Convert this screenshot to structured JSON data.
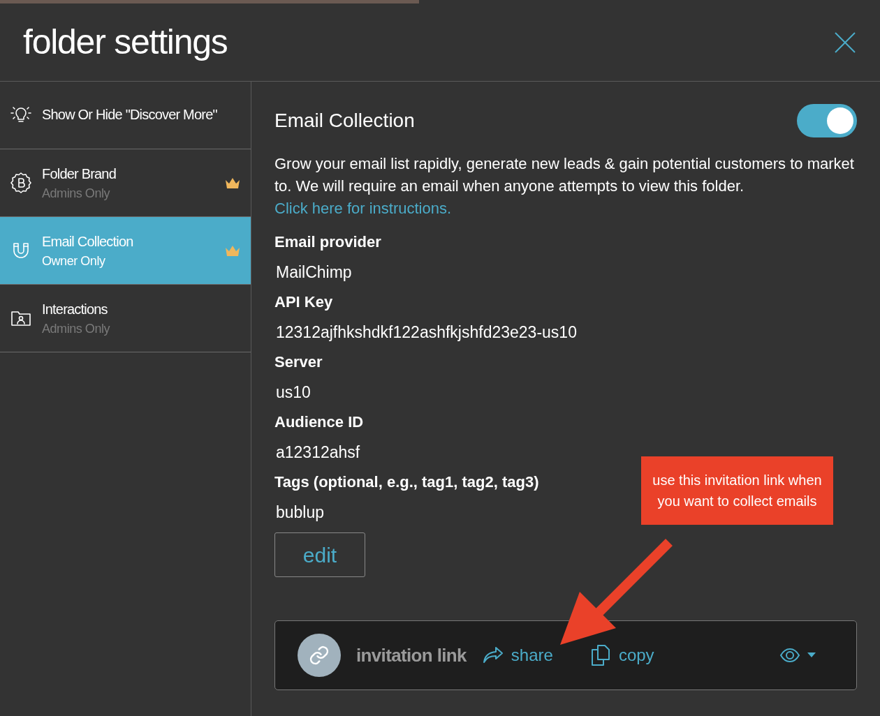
{
  "dialog": {
    "title": "folder settings"
  },
  "sidebar": {
    "items": [
      {
        "title": "Show Or Hide \"Discover More\"",
        "premium": false,
        "selected": false
      },
      {
        "title": "Folder Brand",
        "subtitle": "Admins Only",
        "premium": true,
        "selected": false
      },
      {
        "title": "Email Collection",
        "subtitle": "Owner Only",
        "premium": true,
        "selected": true
      },
      {
        "title": "Interactions",
        "subtitle": "Admins Only",
        "premium": false,
        "selected": false
      }
    ]
  },
  "panel": {
    "title": "Email Collection",
    "enabled": true,
    "description": "Grow your email list rapidly, generate new leads & gain potential customers to market to. We will require an email when anyone attempts to view this folder.",
    "link": "Click here for instructions.",
    "fields": [
      {
        "label": "Email provider",
        "value": "MailChimp"
      },
      {
        "label": "API Key",
        "value": "12312ajfhkshdkf122ashfkjshfd23e23-us10"
      },
      {
        "label": "Server",
        "value": "us10"
      },
      {
        "label": "Audience ID",
        "value": "a12312ahsf"
      },
      {
        "label": "Tags (optional, e.g., tag1, tag2, tag3)",
        "value": "bublup"
      }
    ],
    "edit_button": "edit",
    "invitation": {
      "label": "invitation link",
      "share": "share",
      "copy": "copy"
    }
  },
  "annotation": {
    "text": "use this invitation link when you want to collect emails"
  }
}
